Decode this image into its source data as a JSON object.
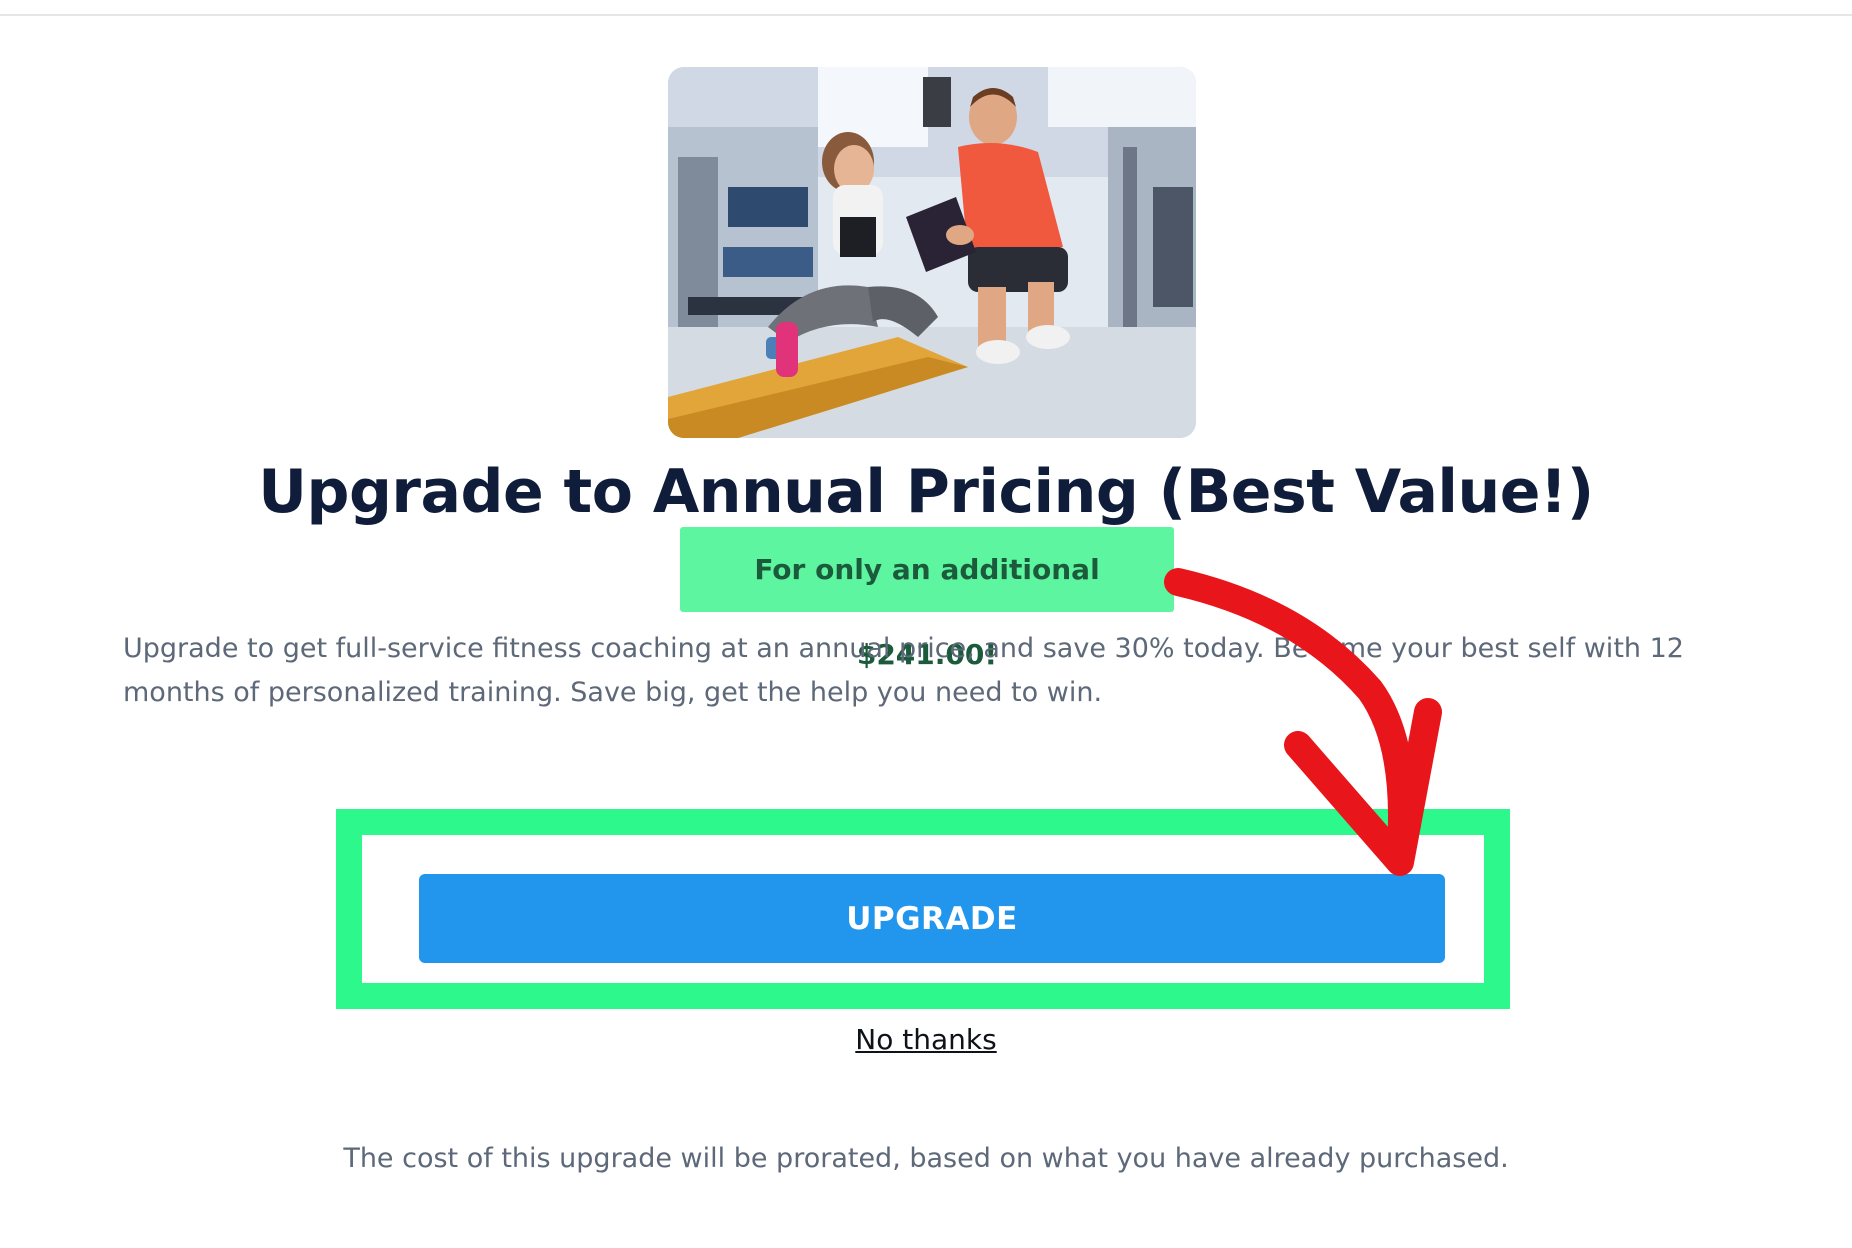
{
  "hero": {
    "image_alt": "Personal trainer with clipboard coaching a woman resting on a gym mat",
    "icon": "gym-photo"
  },
  "offer": {
    "headline": "Upgrade to Annual Pricing (Best Value!)",
    "price_badge": "For only an additional $241.00!",
    "description": "Upgrade to get full-service fitness coaching at an annual price, and save 30% today. Become your best self with 12 months of personalized training. Save big, get the help you need to win."
  },
  "actions": {
    "upgrade_label": "UPGRADE",
    "decline_label": "No thanks"
  },
  "footer": {
    "note": "The cost of this upgrade will be prorated, based on what you have already purchased."
  },
  "colors": {
    "headline": "#0f1d3a",
    "badge_bg": "#5ef5a0",
    "badge_text": "#1c5a3c",
    "button_bg": "#2196ec",
    "highlight_frame": "#2cf88c",
    "annotation_arrow": "#e8151b"
  }
}
